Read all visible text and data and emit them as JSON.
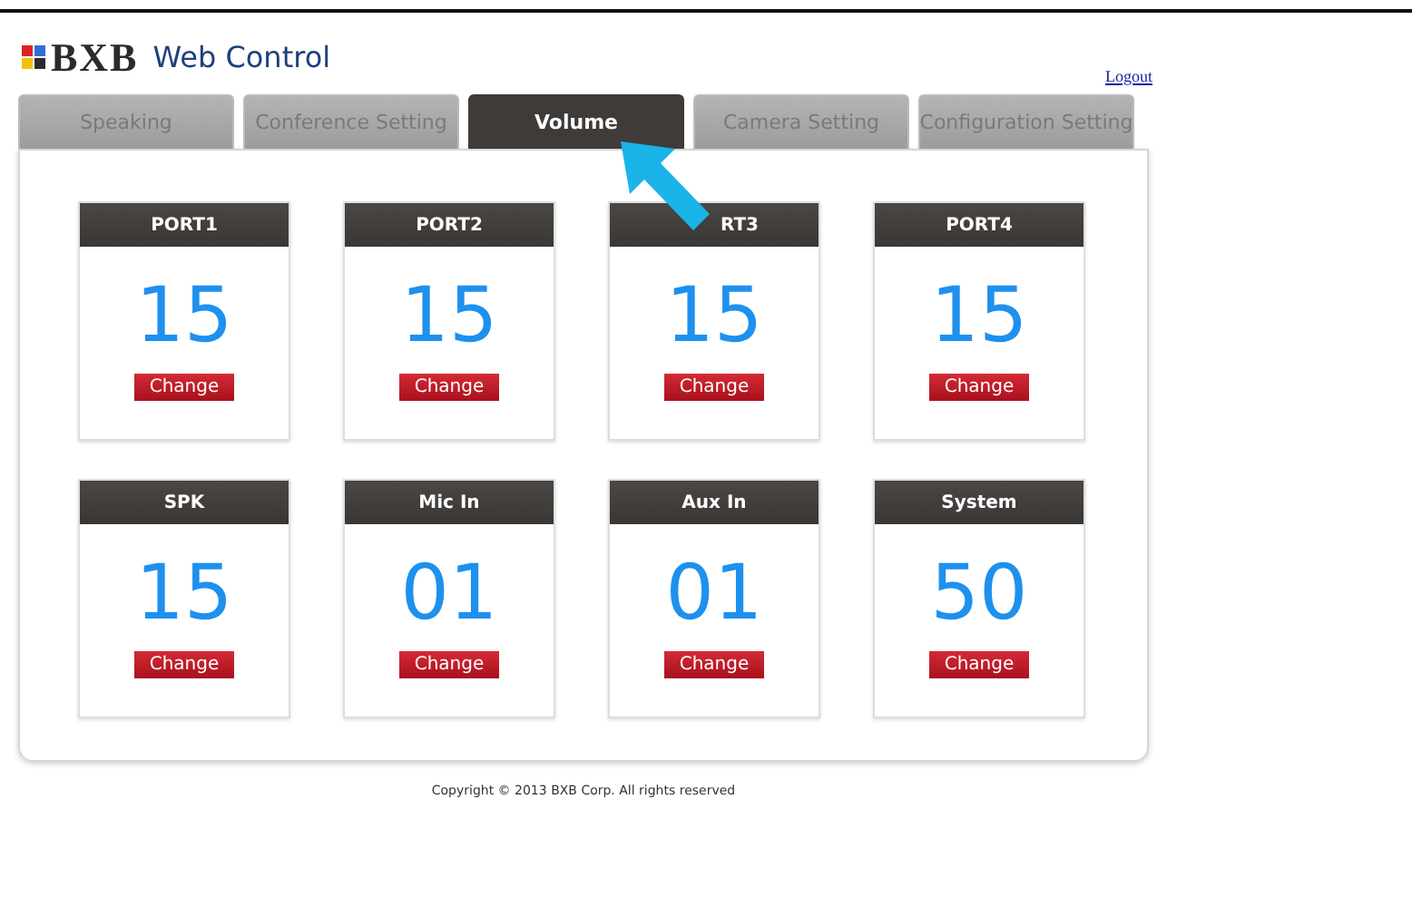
{
  "header": {
    "brand": "BXB",
    "title": "Web Control",
    "logout": "Logout"
  },
  "tabs": [
    {
      "label": "Speaking",
      "selected": false
    },
    {
      "label": "Conference Setting",
      "selected": false
    },
    {
      "label": "Volume",
      "selected": true
    },
    {
      "label": "Camera Setting",
      "selected": false
    },
    {
      "label": "Configuration Setting",
      "selected": false
    }
  ],
  "volumes": [
    {
      "name": "PORT1",
      "value": "15",
      "button": "Change"
    },
    {
      "name": "PORT2",
      "value": "15",
      "button": "Change"
    },
    {
      "name": "RT3",
      "value": "15",
      "button": "Change",
      "covered": true
    },
    {
      "name": "PORT4",
      "value": "15",
      "button": "Change"
    },
    {
      "name": "SPK",
      "value": "15",
      "button": "Change"
    },
    {
      "name": "Mic In",
      "value": "01",
      "button": "Change"
    },
    {
      "name": "Aux In",
      "value": "01",
      "button": "Change"
    },
    {
      "name": "System",
      "value": "50",
      "button": "Change"
    }
  ],
  "footer": "Copyright © 2013 BXB Corp. All rights reserved"
}
